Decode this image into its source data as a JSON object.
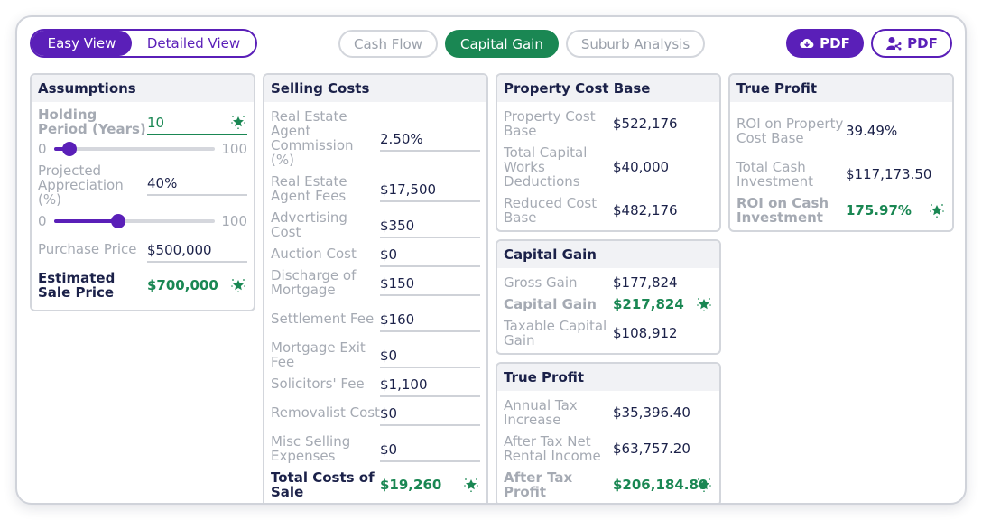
{
  "view_toggle": {
    "options": [
      {
        "label": "Easy View",
        "active": true
      },
      {
        "label": "Detailed View",
        "active": false
      }
    ]
  },
  "tabs": [
    {
      "label": "Cash Flow",
      "active": false
    },
    {
      "label": "Capital Gain",
      "active": true
    },
    {
      "label": "Suburb Analysis",
      "active": false
    }
  ],
  "pdf_buttons": [
    {
      "label": "PDF",
      "icon": "cloud-download-icon"
    },
    {
      "label": "PDF",
      "icon": "share-user-icon"
    }
  ],
  "colors": {
    "primary_purple": "#5a1fb8",
    "accent_green": "#1a8753",
    "label_gray": "#a5aab3",
    "text_navy": "#1b2149"
  },
  "assumptions": {
    "title": "Assumptions",
    "holding_period": {
      "label": "Holding Period (Years)",
      "value": "10",
      "slider_min": "0",
      "slider_max": "100",
      "slider_value": 10
    },
    "projected_appreciation": {
      "label": "Projected Appreciation (%)",
      "value": "40%",
      "slider_min": "0",
      "slider_max": "100",
      "slider_value": 40
    },
    "purchase_price": {
      "label": "Purchase Price",
      "value": "$500,000"
    },
    "estimated_sale_price": {
      "label": "Estimated Sale Price",
      "value": "$700,000"
    }
  },
  "selling_costs": {
    "title": "Selling Costs",
    "items": [
      {
        "label": "Real Estate Agent Commission (%)",
        "value": "2.50%"
      },
      {
        "label": "Real Estate Agent Fees",
        "value": "$17,500"
      },
      {
        "label": "Advertising Cost",
        "value": "$350"
      },
      {
        "label": "Auction Cost",
        "value": "$0"
      },
      {
        "label": "Discharge of Mortgage",
        "value": "$150"
      },
      {
        "label": "Settlement Fee",
        "value": "$160"
      },
      {
        "label": "Mortgage Exit Fee",
        "value": "$0"
      },
      {
        "label": "Solicitors' Fee",
        "value": "$1,100"
      },
      {
        "label": "Removalist Cost",
        "value": "$0"
      },
      {
        "label": "Misc Selling Expenses",
        "value": "$0"
      }
    ],
    "total": {
      "label": "Total Costs of Sale",
      "value": "$19,260"
    }
  },
  "property_cost_base": {
    "title": "Property Cost Base",
    "items": [
      {
        "label": "Property Cost Base",
        "value": "$522,176"
      },
      {
        "label": "Total Capital Works Deductions",
        "value": "$40,000"
      },
      {
        "label": "Reduced Cost Base",
        "value": "$482,176"
      }
    ]
  },
  "capital_gain": {
    "title": "Capital Gain",
    "items": [
      {
        "label": "Gross Gain",
        "value": "$177,824"
      },
      {
        "label": "Capital Gain",
        "value": "$217,824"
      },
      {
        "label": "Taxable Capital Gain",
        "value": "$108,912"
      }
    ]
  },
  "true_profit_mid": {
    "title": "True Profit",
    "items": [
      {
        "label": "Annual Tax Increase",
        "value": "$35,396.40"
      },
      {
        "label": "After Tax Net Rental Income",
        "value": "$63,757.20"
      },
      {
        "label": "After Tax Profit",
        "value": "$206,184.80"
      }
    ]
  },
  "true_profit_right": {
    "title": "True Profit",
    "items": [
      {
        "label": "ROI on Property Cost Base",
        "value": "39.49%"
      },
      {
        "label": "Total Cash Investment",
        "value": "$117,173.50"
      },
      {
        "label": "ROI on Cash Investment",
        "value": "175.97%"
      }
    ]
  }
}
